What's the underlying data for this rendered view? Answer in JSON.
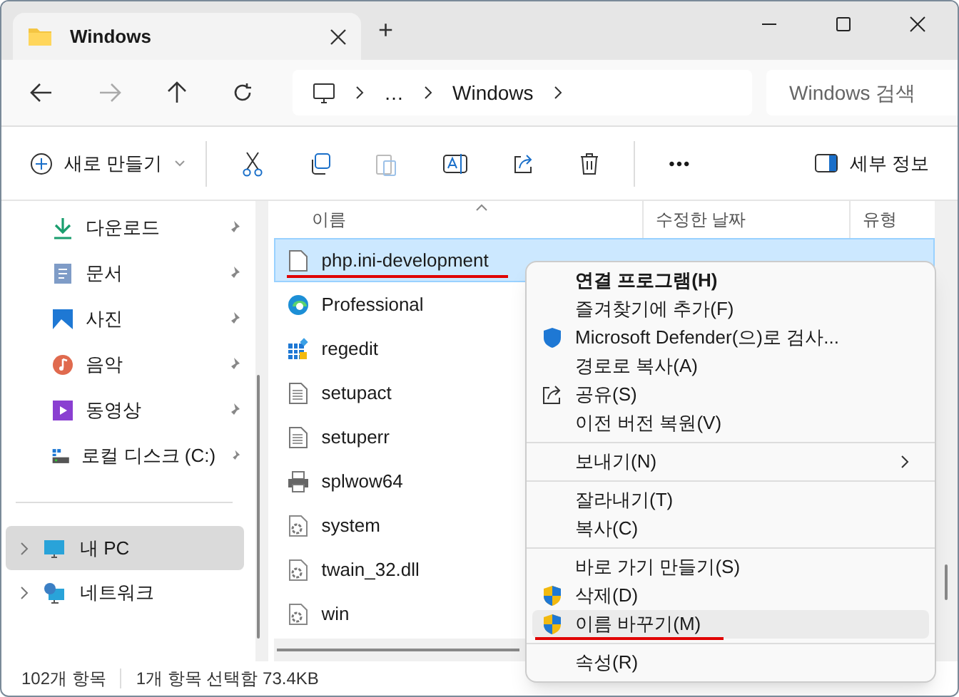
{
  "window": {
    "tab_title": "Windows",
    "new_tab": "+"
  },
  "toolbar": {
    "breadcrumb": [
      "…",
      "Windows"
    ],
    "search": {
      "placeholder": "Windows 검색"
    }
  },
  "commands": {
    "new": "새로 만들기",
    "more": "•••",
    "details": "세부 정보"
  },
  "sidebar": {
    "items": [
      {
        "label": "다운로드",
        "pinned": true
      },
      {
        "label": "문서",
        "pinned": true
      },
      {
        "label": "사진",
        "pinned": true
      },
      {
        "label": "음악",
        "pinned": true
      },
      {
        "label": "동영상",
        "pinned": true
      },
      {
        "label": "로컬 디스크 (C:)",
        "pinned": true
      }
    ],
    "tree": [
      {
        "label": "내 PC",
        "selected": true
      },
      {
        "label": "네트워크",
        "selected": false
      }
    ]
  },
  "table": {
    "columns": [
      "이름",
      "수정한 날짜",
      "유형"
    ],
    "rows": [
      {
        "name": "php.ini-development",
        "selected": true,
        "underlined": true
      },
      {
        "name": "Professional",
        "selected": false,
        "underlined": false
      },
      {
        "name": "regedit",
        "selected": false,
        "underlined": false
      },
      {
        "name": "setupact",
        "selected": false,
        "underlined": false
      },
      {
        "name": "setuperr",
        "selected": false,
        "underlined": false
      },
      {
        "name": "splwow64",
        "selected": false,
        "underlined": false
      },
      {
        "name": "system",
        "selected": false,
        "underlined": false
      },
      {
        "name": "twain_32.dll",
        "selected": false,
        "underlined": false
      },
      {
        "name": "win",
        "selected": false,
        "underlined": false
      }
    ]
  },
  "context_menu": {
    "groups": [
      [
        {
          "label": "연결 프로그램(H)",
          "bold": true,
          "submenu": false,
          "selected": false,
          "underlined": false
        },
        {
          "label": "즐겨찾기에 추가(F)",
          "bold": false,
          "submenu": false,
          "selected": false,
          "underlined": false
        },
        {
          "label": "Microsoft Defender(으)로 검사...",
          "bold": false,
          "submenu": false,
          "selected": false,
          "underlined": false
        },
        {
          "label": "경로로 복사(A)",
          "bold": false,
          "submenu": false,
          "selected": false,
          "underlined": false
        },
        {
          "label": "공유(S)",
          "bold": false,
          "submenu": false,
          "selected": false,
          "underlined": false
        },
        {
          "label": "이전 버전 복원(V)",
          "bold": false,
          "submenu": false,
          "selected": false,
          "underlined": false
        }
      ],
      [
        {
          "label": "보내기(N)",
          "bold": false,
          "submenu": true,
          "selected": false,
          "underlined": false
        }
      ],
      [
        {
          "label": "잘라내기(T)",
          "bold": false,
          "submenu": false,
          "selected": false,
          "underlined": false
        },
        {
          "label": "복사(C)",
          "bold": false,
          "submenu": false,
          "selected": false,
          "underlined": false
        }
      ],
      [
        {
          "label": "바로 가기 만들기(S)",
          "bold": false,
          "submenu": false,
          "selected": false,
          "underlined": false
        },
        {
          "label": "삭제(D)",
          "bold": false,
          "submenu": false,
          "selected": false,
          "underlined": false
        },
        {
          "label": "이름 바꾸기(M)",
          "bold": false,
          "submenu": false,
          "selected": true,
          "underlined": true
        }
      ],
      [
        {
          "label": "속성(R)",
          "bold": false,
          "submenu": false,
          "selected": false,
          "underlined": false
        }
      ]
    ]
  },
  "status_bar": {
    "count": "102개 항목",
    "selection": "1개 항목 선택함 73.4KB"
  }
}
